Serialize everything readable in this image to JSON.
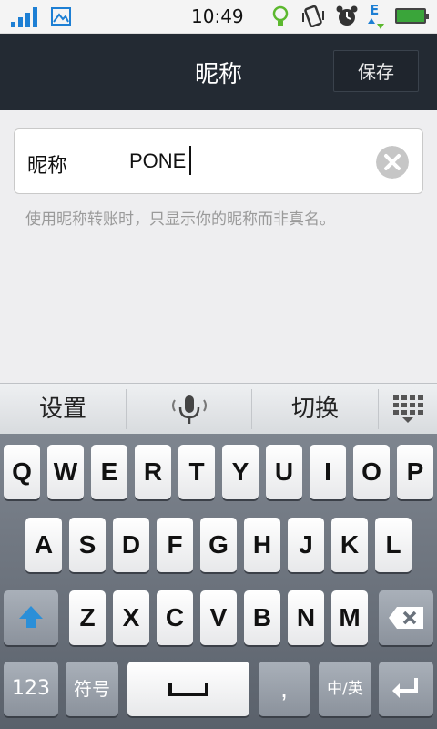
{
  "status_bar": {
    "time": "10:49",
    "network_type": "E",
    "icons": [
      "signal-icon",
      "image-icon",
      "bulb-icon",
      "vibrate-icon",
      "alarm-icon",
      "network-icon",
      "battery-icon"
    ]
  },
  "header": {
    "title": "昵称",
    "save_label": "保存"
  },
  "field": {
    "label": "昵称",
    "value": "PONE"
  },
  "hint": "使用昵称转账时，只显示你的昵称而非真名。",
  "keyboard": {
    "toolbar": {
      "settings": "设置",
      "switch": "切换"
    },
    "row1": [
      "Q",
      "W",
      "E",
      "R",
      "T",
      "Y",
      "U",
      "I",
      "O",
      "P"
    ],
    "row2": [
      "A",
      "S",
      "D",
      "F",
      "G",
      "H",
      "J",
      "K",
      "L"
    ],
    "row3": [
      "Z",
      "X",
      "C",
      "V",
      "B",
      "N",
      "M"
    ],
    "num_key": "123",
    "symbol_key": "符号",
    "comma_key": ",",
    "lang_key": "中/英"
  },
  "colors": {
    "header_bg": "#232a33",
    "background": "#eeeef0",
    "signal_blue": "#1d7fd4"
  }
}
